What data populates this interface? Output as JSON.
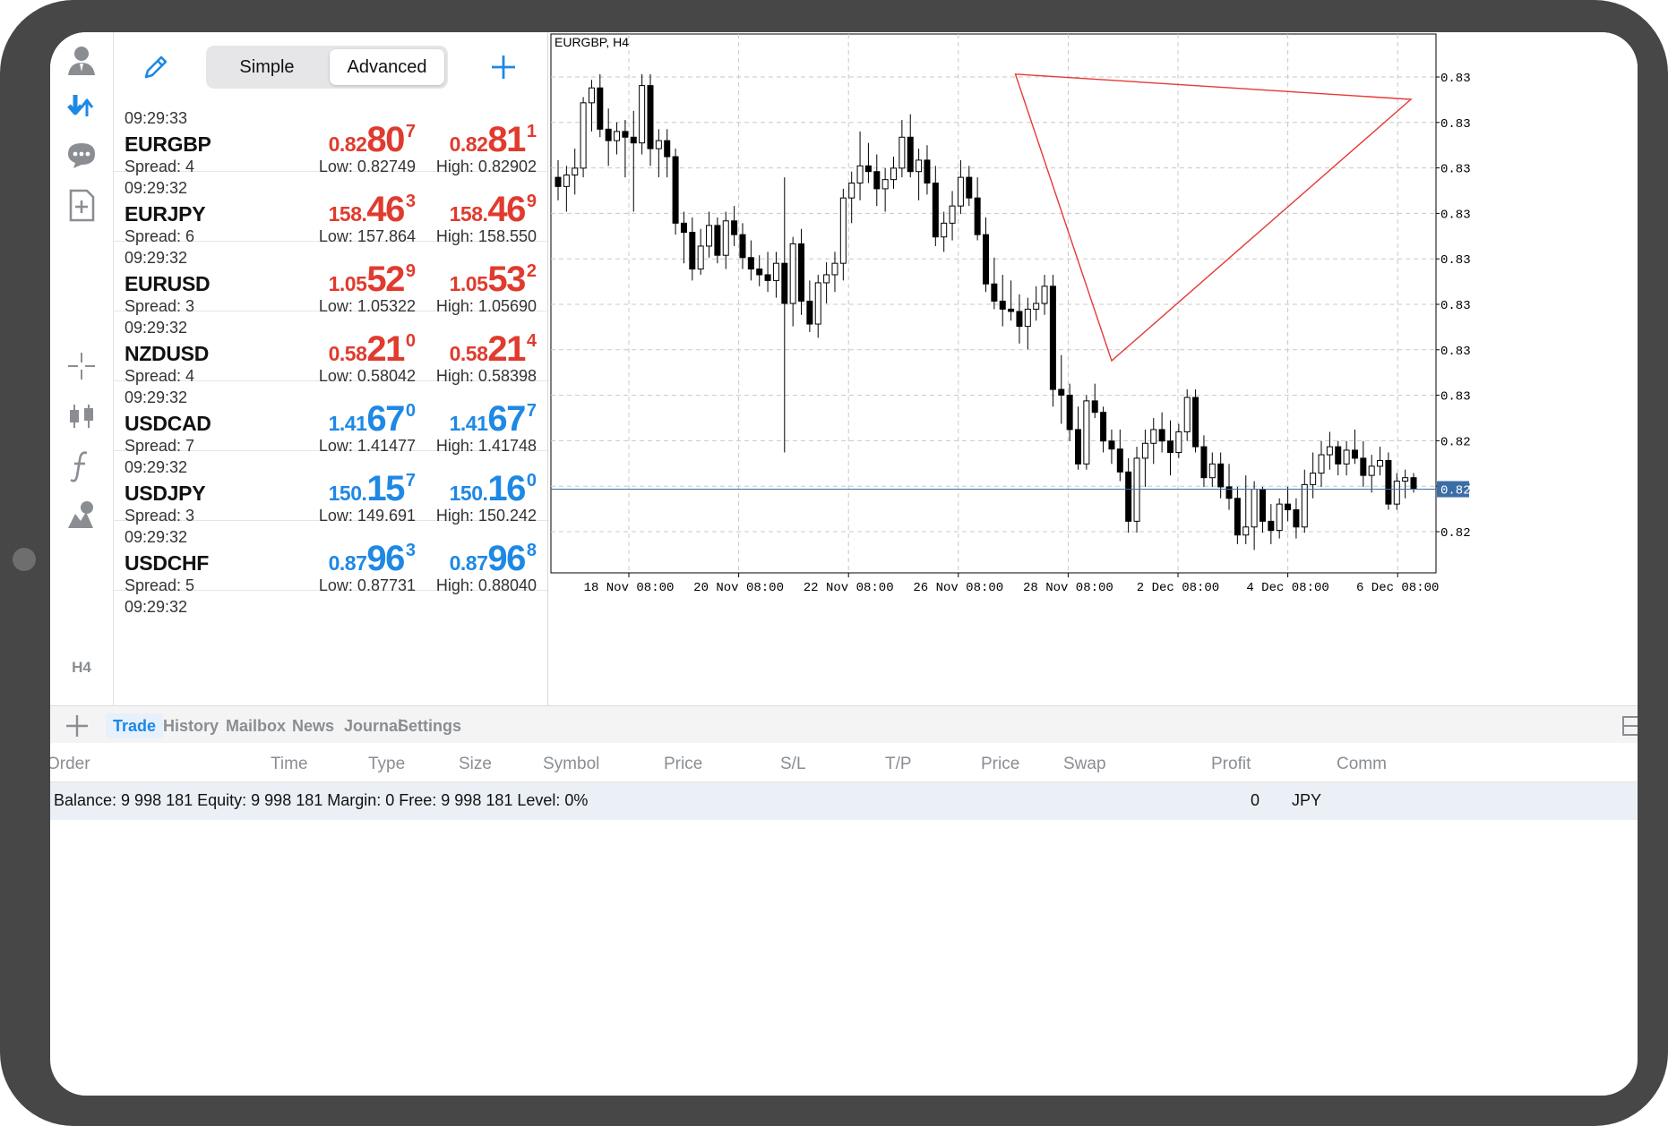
{
  "left_toolbar": {
    "icons": [
      "account-icon",
      "quotes-icon",
      "chat-icon",
      "new-order-icon",
      "crosshair-icon",
      "chart-type-icon",
      "indicators-icon",
      "objects-icon"
    ],
    "timeframe": "H4"
  },
  "quotes_header": {
    "simple_label": "Simple",
    "advanced_label": "Advanced",
    "mode": "Advanced"
  },
  "quotes": [
    {
      "time": "09:29:33",
      "symbol": "EURGBP",
      "spread": "Spread: 4",
      "bid_pre": "0.82",
      "bid_big": "80",
      "bid_sup": "7",
      "ask_pre": "0.82",
      "ask_big": "81",
      "ask_sup": "1",
      "low": "Low: 0.82749",
      "high": "High: 0.82902",
      "color": "red"
    },
    {
      "time": "09:29:32",
      "symbol": "EURJPY",
      "spread": "Spread: 6",
      "bid_pre": "158.",
      "bid_big": "46",
      "bid_sup": "3",
      "ask_pre": "158.",
      "ask_big": "46",
      "ask_sup": "9",
      "low": "Low: 157.864",
      "high": "High: 158.550",
      "color": "red"
    },
    {
      "time": "09:29:32",
      "symbol": "EURUSD",
      "spread": "Spread: 3",
      "bid_pre": "1.05",
      "bid_big": "52",
      "bid_sup": "9",
      "ask_pre": "1.05",
      "ask_big": "53",
      "ask_sup": "2",
      "low": "Low: 1.05322",
      "high": "High: 1.05690",
      "color": "red"
    },
    {
      "time": "09:29:32",
      "symbol": "NZDUSD",
      "spread": "Spread: 4",
      "bid_pre": "0.58",
      "bid_big": "21",
      "bid_sup": "0",
      "ask_pre": "0.58",
      "ask_big": "21",
      "ask_sup": "4",
      "low": "Low: 0.58042",
      "high": "High: 0.58398",
      "color": "red"
    },
    {
      "time": "09:29:32",
      "symbol": "USDCAD",
      "spread": "Spread: 7",
      "bid_pre": "1.41",
      "bid_big": "67",
      "bid_sup": "0",
      "ask_pre": "1.41",
      "ask_big": "67",
      "ask_sup": "7",
      "low": "Low: 1.41477",
      "high": "High: 1.41748",
      "color": "blue"
    },
    {
      "time": "09:29:32",
      "symbol": "USDJPY",
      "spread": "Spread: 3",
      "bid_pre": "150.",
      "bid_big": "15",
      "bid_sup": "7",
      "ask_pre": "150.",
      "ask_big": "16",
      "ask_sup": "0",
      "low": "Low: 149.691",
      "high": "High: 150.242",
      "color": "blue"
    },
    {
      "time": "09:29:32",
      "symbol": "USDCHF",
      "spread": "Spread: 5",
      "bid_pre": "0.87",
      "bid_big": "96",
      "bid_sup": "3",
      "ask_pre": "0.87",
      "ask_big": "96",
      "ask_sup": "8",
      "low": "Low: 0.87731",
      "high": "High: 0.88040",
      "color": "blue"
    },
    {
      "time": "09:29:32"
    }
  ],
  "chart": {
    "title": "EURGBP, H4",
    "x_labels": [
      "18 Nov 08:00",
      "20 Nov 08:00",
      "22 Nov 08:00",
      "26 Nov 08:00",
      "28 Nov 08:00",
      "2 Dec 08:00",
      "4 Dec 08:00",
      "6 Dec 08:00"
    ],
    "y_labels": [
      "0.83",
      "0.83",
      "0.83",
      "0.83",
      "0.83",
      "0.83",
      "0.83",
      "0.83",
      "0.82",
      "0.82",
      "0.82"
    ],
    "current_price_label": "0.82",
    "colors": {
      "up": "#ffffff",
      "down": "#000000",
      "grid": "#c8c8c8",
      "triangle": "#e53935",
      "price_line": "#3a6ea5"
    }
  },
  "chart_data": {
    "type": "candlestick",
    "title": "EURGBP, H4",
    "candles": [
      [
        0.833,
        0.8345,
        0.831,
        0.8322
      ],
      [
        0.8322,
        0.834,
        0.83,
        0.8332
      ],
      [
        0.8332,
        0.8355,
        0.8315,
        0.8338
      ],
      [
        0.8338,
        0.84,
        0.833,
        0.8395
      ],
      [
        0.8395,
        0.8415,
        0.837,
        0.8408
      ],
      [
        0.8408,
        0.842,
        0.8365,
        0.8372
      ],
      [
        0.8372,
        0.839,
        0.834,
        0.8362
      ],
      [
        0.8362,
        0.8378,
        0.835,
        0.837
      ],
      [
        0.837,
        0.838,
        0.833,
        0.8365
      ],
      [
        0.8365,
        0.8388,
        0.83,
        0.836
      ],
      [
        0.836,
        0.842,
        0.835,
        0.841
      ],
      [
        0.841,
        0.842,
        0.834,
        0.8355
      ],
      [
        0.8355,
        0.8372,
        0.833,
        0.8362
      ],
      [
        0.8362,
        0.8372,
        0.833,
        0.8348
      ],
      [
        0.8348,
        0.8355,
        0.828,
        0.829
      ],
      [
        0.829,
        0.83,
        0.8255,
        0.8282
      ],
      [
        0.8282,
        0.8295,
        0.824,
        0.825
      ],
      [
        0.825,
        0.8285,
        0.8245,
        0.827
      ],
      [
        0.827,
        0.83,
        0.826,
        0.8288
      ],
      [
        0.8288,
        0.8295,
        0.8255,
        0.8262
      ],
      [
        0.8262,
        0.83,
        0.825,
        0.8292
      ],
      [
        0.8292,
        0.8305,
        0.827,
        0.828
      ],
      [
        0.828,
        0.829,
        0.825,
        0.826
      ],
      [
        0.826,
        0.8275,
        0.824,
        0.825
      ],
      [
        0.825,
        0.8262,
        0.8235,
        0.8245
      ],
      [
        0.8245,
        0.8265,
        0.823,
        0.824
      ],
      [
        0.824,
        0.8265,
        0.8225,
        0.8255
      ],
      [
        0.8255,
        0.833,
        0.809,
        0.822
      ],
      [
        0.822,
        0.8278,
        0.82,
        0.8272
      ],
      [
        0.8272,
        0.8285,
        0.821,
        0.8222
      ],
      [
        0.8222,
        0.824,
        0.8195,
        0.8202
      ],
      [
        0.8202,
        0.8245,
        0.819,
        0.8238
      ],
      [
        0.8238,
        0.8256,
        0.822,
        0.8245
      ],
      [
        0.8245,
        0.8265,
        0.823,
        0.8255
      ],
      [
        0.8255,
        0.832,
        0.824,
        0.8312
      ],
      [
        0.8312,
        0.8335,
        0.829,
        0.8325
      ],
      [
        0.8325,
        0.837,
        0.831,
        0.834
      ],
      [
        0.834,
        0.836,
        0.8325,
        0.8335
      ],
      [
        0.8335,
        0.835,
        0.8305,
        0.832
      ],
      [
        0.832,
        0.8338,
        0.83,
        0.8328
      ],
      [
        0.8328,
        0.8348,
        0.832,
        0.8338
      ],
      [
        0.8338,
        0.838,
        0.833,
        0.8365
      ],
      [
        0.8365,
        0.8385,
        0.833,
        0.8335
      ],
      [
        0.8335,
        0.8355,
        0.831,
        0.8345
      ],
      [
        0.8345,
        0.8358,
        0.8315,
        0.8325
      ],
      [
        0.8325,
        0.834,
        0.827,
        0.8278
      ],
      [
        0.8278,
        0.83,
        0.8265,
        0.829
      ],
      [
        0.829,
        0.8318,
        0.8275,
        0.8305
      ],
      [
        0.8305,
        0.8345,
        0.8298,
        0.833
      ],
      [
        0.833,
        0.834,
        0.8305,
        0.8312
      ],
      [
        0.8312,
        0.833,
        0.8275,
        0.828
      ],
      [
        0.828,
        0.8295,
        0.823,
        0.8237
      ],
      [
        0.8237,
        0.826,
        0.8215,
        0.8222
      ],
      [
        0.8222,
        0.8245,
        0.82,
        0.8215
      ],
      [
        0.8215,
        0.824,
        0.8205,
        0.8213
      ],
      [
        0.8213,
        0.8228,
        0.8185,
        0.82
      ],
      [
        0.82,
        0.8225,
        0.818,
        0.8215
      ],
      [
        0.8215,
        0.8235,
        0.8205,
        0.822
      ],
      [
        0.822,
        0.8245,
        0.821,
        0.8235
      ],
      [
        0.8235,
        0.8245,
        0.813,
        0.8145
      ],
      [
        0.8145,
        0.8175,
        0.8115,
        0.814
      ],
      [
        0.814,
        0.815,
        0.81,
        0.811
      ],
      [
        0.811,
        0.813,
        0.8075,
        0.808
      ],
      [
        0.808,
        0.814,
        0.8075,
        0.8135
      ],
      [
        0.8135,
        0.815,
        0.812,
        0.8125
      ],
      [
        0.8125,
        0.813,
        0.809,
        0.81
      ],
      [
        0.81,
        0.811,
        0.808,
        0.8093
      ],
      [
        0.8093,
        0.811,
        0.8065,
        0.8073
      ],
      [
        0.8073,
        0.8085,
        0.802,
        0.803
      ],
      [
        0.803,
        0.8095,
        0.802,
        0.8085
      ],
      [
        0.8085,
        0.811,
        0.806,
        0.8098
      ],
      [
        0.8098,
        0.812,
        0.808,
        0.811
      ],
      [
        0.811,
        0.8125,
        0.809,
        0.81
      ],
      [
        0.81,
        0.8118,
        0.807,
        0.809
      ],
      [
        0.809,
        0.8115,
        0.8085,
        0.8108
      ],
      [
        0.8108,
        0.8145,
        0.81,
        0.8138
      ],
      [
        0.8138,
        0.8145,
        0.809,
        0.8095
      ],
      [
        0.8095,
        0.8105,
        0.806,
        0.8068
      ],
      [
        0.8068,
        0.809,
        0.806,
        0.808
      ],
      [
        0.808,
        0.809,
        0.805,
        0.806
      ],
      [
        0.806,
        0.808,
        0.804,
        0.805
      ],
      [
        0.805,
        0.806,
        0.801,
        0.8018
      ],
      [
        0.8018,
        0.807,
        0.801,
        0.8025
      ],
      [
        0.8025,
        0.8065,
        0.8005,
        0.8058
      ],
      [
        0.8058,
        0.806,
        0.802,
        0.803
      ],
      [
        0.803,
        0.8045,
        0.801,
        0.8022
      ],
      [
        0.8022,
        0.805,
        0.8015,
        0.8045
      ],
      [
        0.8045,
        0.806,
        0.803,
        0.804
      ],
      [
        0.804,
        0.805,
        0.8015,
        0.8025
      ],
      [
        0.8025,
        0.8075,
        0.802,
        0.8062
      ],
      [
        0.8062,
        0.809,
        0.805,
        0.8072
      ],
      [
        0.8072,
        0.81,
        0.806,
        0.8088
      ],
      [
        0.8088,
        0.8108,
        0.8075,
        0.8095
      ],
      [
        0.8095,
        0.81,
        0.807,
        0.808
      ],
      [
        0.808,
        0.81,
        0.807,
        0.8092
      ],
      [
        0.8092,
        0.811,
        0.808,
        0.8085
      ],
      [
        0.8085,
        0.81,
        0.806,
        0.807
      ],
      [
        0.807,
        0.8088,
        0.8055,
        0.8078
      ],
      [
        0.8078,
        0.8095,
        0.807,
        0.8083
      ],
      [
        0.8083,
        0.809,
        0.804,
        0.8045
      ],
      [
        0.8045,
        0.8072,
        0.804,
        0.8065
      ],
      [
        0.8065,
        0.8075,
        0.805,
        0.8068
      ],
      [
        0.8068,
        0.8072,
        0.8055,
        0.8058
      ]
    ],
    "current_price_line": 0.8058,
    "triangle": [
      [
        0.842
      ],
      [
        0.817
      ],
      [
        0.8398
      ]
    ]
  },
  "bottom_tabs": [
    "Trade",
    "History",
    "Mailbox",
    "News",
    "Journal",
    "Settings"
  ],
  "active_tab": "Trade",
  "table_headers": [
    "Order",
    "Time",
    "Type",
    "Size",
    "Symbol",
    "Price",
    "S/L",
    "T/P",
    "Price",
    "Swap",
    "Profit",
    "Comm"
  ],
  "balance": {
    "text": "Balance: 9 998 181 Equity: 9 998 181 Margin: 0 Free: 9 998 181 Level: 0%",
    "profit": "0",
    "currency": "JPY"
  }
}
